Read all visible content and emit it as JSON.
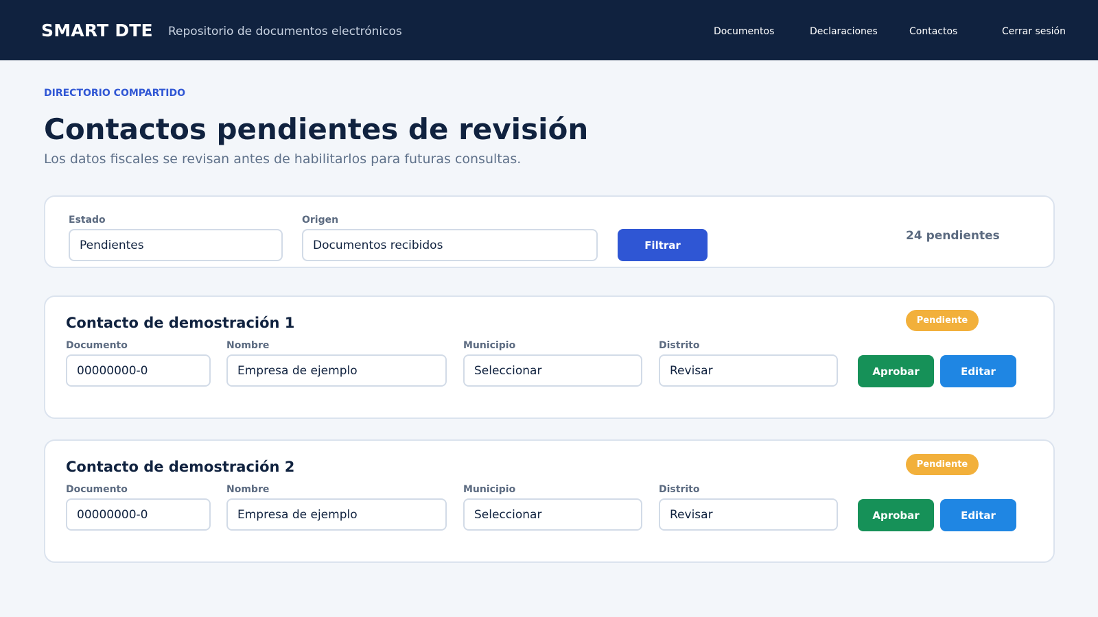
{
  "header": {
    "brand": "SMART DTE",
    "tagline": "Repositorio de documentos electrónicos",
    "nav": [
      "Documentos",
      "Declaraciones",
      "Contactos",
      "Cerrar sesión"
    ]
  },
  "page": {
    "eyebrow": "DIRECTORIO COMPARTIDO",
    "title": "Contactos pendientes de revisión",
    "subtitle": "Los datos fiscales se revisan antes de habilitarlos para futuras consultas."
  },
  "filters": {
    "estado_label": "Estado",
    "estado_value": "Pendientes",
    "origen_label": "Origen",
    "origen_value": "Documentos recibidos",
    "filter_button": "Filtrar",
    "count_text": "24 pendientes"
  },
  "contacts": [
    {
      "title": "Contacto de demostración 1",
      "status": "Pendiente",
      "documento_label": "Documento",
      "documento": "00000000-0",
      "nombre_label": "Nombre",
      "nombre": "Empresa de ejemplo",
      "municipio_label": "Municipio",
      "municipio": "Seleccionar",
      "distrito_label": "Distrito",
      "distrito": "Revisar",
      "approve_label": "Aprobar",
      "edit_label": "Editar"
    },
    {
      "title": "Contacto de demostración 2",
      "status": "Pendiente",
      "documento_label": "Documento",
      "documento": "00000000-0",
      "nombre_label": "Nombre",
      "nombre": "Empresa de ejemplo",
      "municipio_label": "Municipio",
      "municipio": "Seleccionar",
      "distrito_label": "Distrito",
      "distrito": "Revisar",
      "approve_label": "Aprobar",
      "edit_label": "Editar"
    }
  ],
  "colors": {
    "header_bg": "#10223f",
    "accent": "#2f56d4",
    "approve": "#169158",
    "edit": "#1f86e3",
    "pending_badge": "#f2b03b"
  }
}
